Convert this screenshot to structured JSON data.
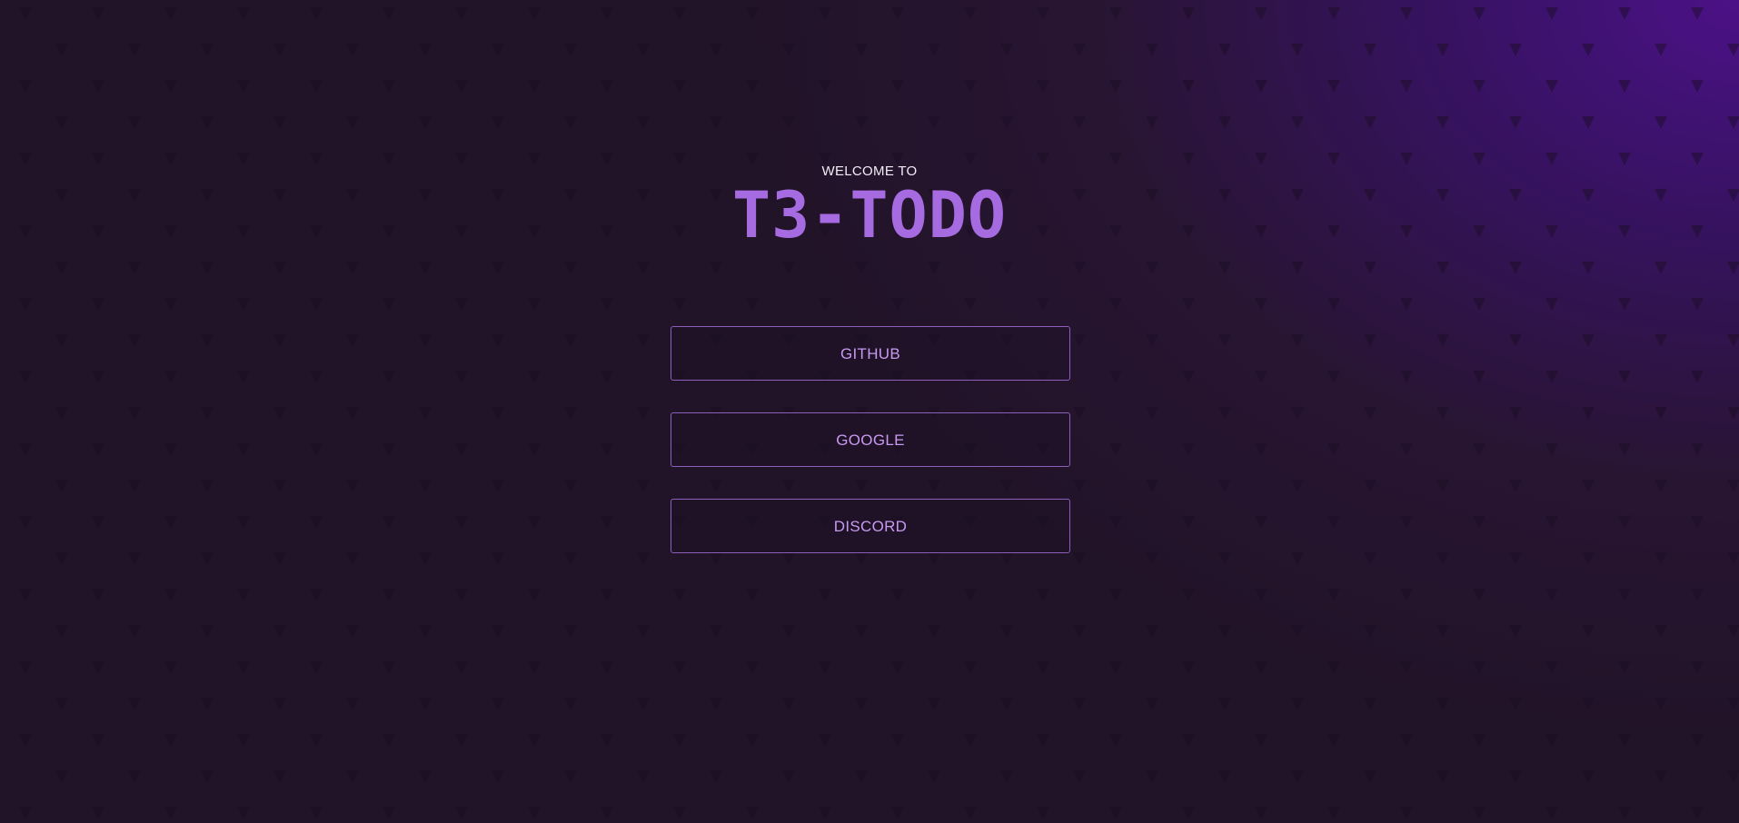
{
  "welcome_text": "WELCOME TO",
  "brand_title": "T3-TODO",
  "providers": [
    {
      "label": "GITHUB"
    },
    {
      "label": "GOOGLE"
    },
    {
      "label": "DISCORD"
    }
  ],
  "colors": {
    "background": "#211328",
    "glow": "#4c1187",
    "title": "#a66be0",
    "button_border": "#8c5fba",
    "button_text": "#c79af0"
  },
  "background_icon": "triangle-pattern-icon"
}
